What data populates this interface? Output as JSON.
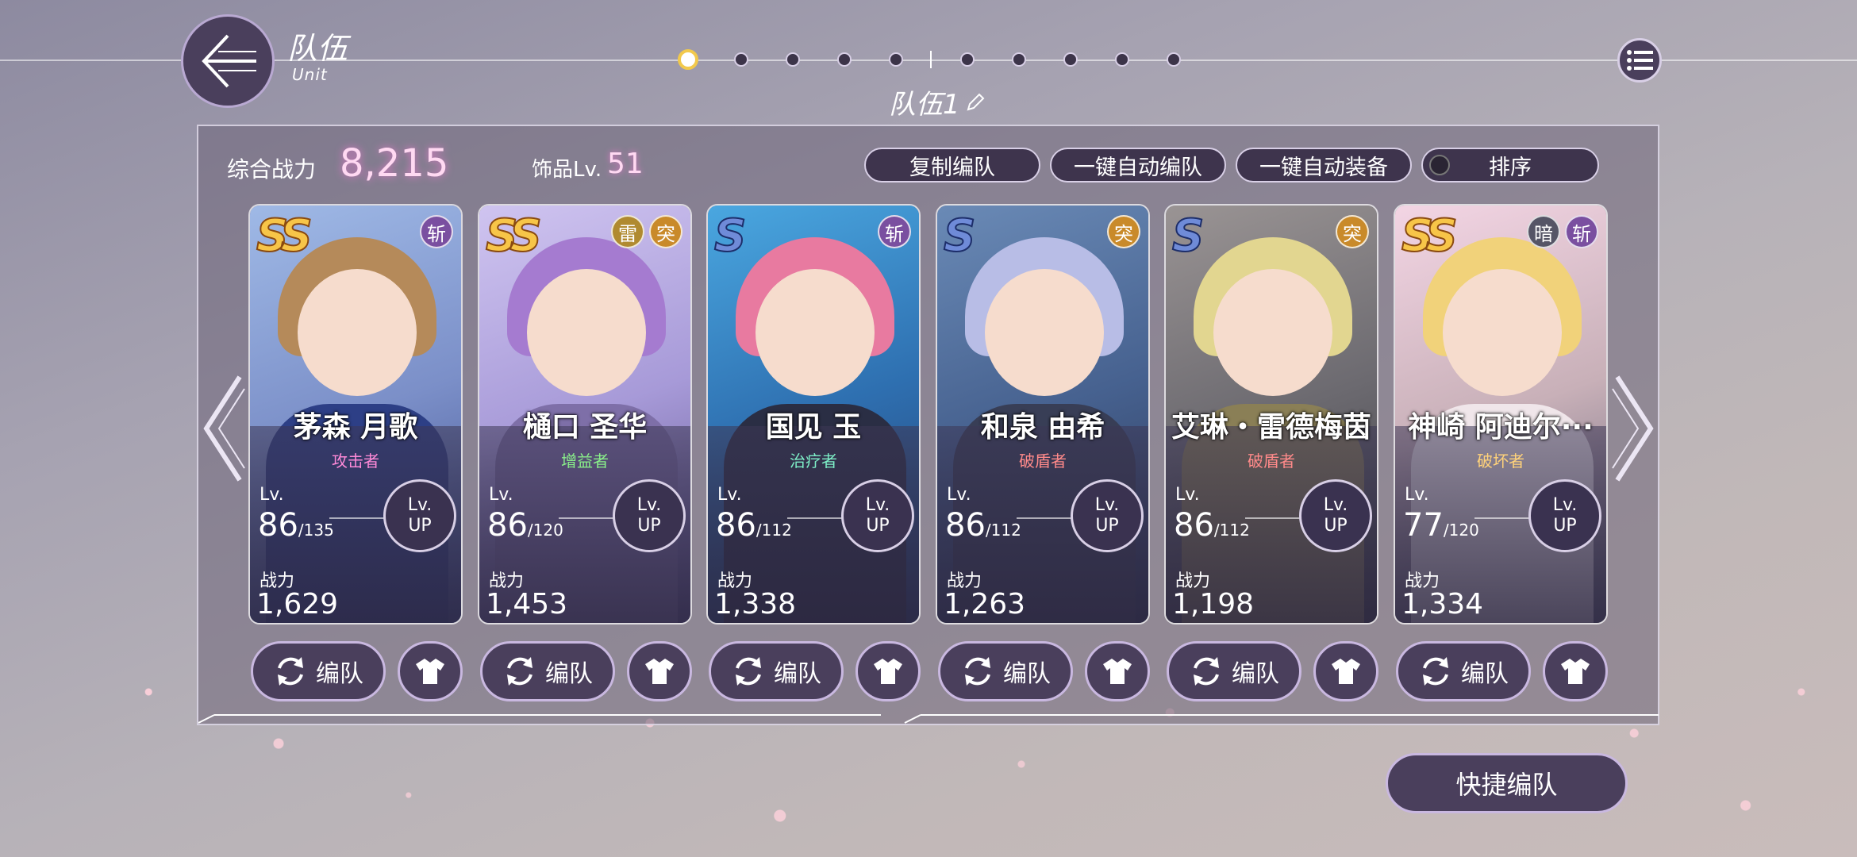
{
  "header": {
    "title": "队伍",
    "subtitle": "Unit",
    "team_name": "队伍1"
  },
  "team_dots": {
    "count": 10,
    "active_index": 0
  },
  "stats": {
    "power_label": "综合战力",
    "power_value": "8,215",
    "accessory_label": "饰品Lv.",
    "accessory_value": "51"
  },
  "toolbar": {
    "copy": "复制编队",
    "auto_team": "一键自动编队",
    "auto_equip": "一键自动装备",
    "sort": "排序"
  },
  "card_labels": {
    "lv": "Lv.",
    "lvup_top": "Lv.",
    "lvup_bottom": "UP",
    "power": "战力",
    "edit": "编队"
  },
  "characters": [
    {
      "name": "茅森 月歌",
      "role": "攻击者",
      "role_color": "#ff8ad8",
      "rarity": "SS",
      "badges": [
        "斩"
      ],
      "lv": "86",
      "lv_max": "/135",
      "power": "1,629"
    },
    {
      "name": "樋口 圣华",
      "role": "增益者",
      "role_color": "#8af08a",
      "rarity": "SS",
      "badges": [
        "雷",
        "突"
      ],
      "lv": "86",
      "lv_max": "/120",
      "power": "1,453"
    },
    {
      "name": "国见 玉",
      "role": "治疗者",
      "role_color": "#7ef0c8",
      "rarity": "S",
      "badges": [
        "斩"
      ],
      "lv": "86",
      "lv_max": "/112",
      "power": "1,338"
    },
    {
      "name": "和泉 由希",
      "role": "破盾者",
      "role_color": "#ff8a8a",
      "rarity": "S",
      "badges": [
        "突"
      ],
      "lv": "86",
      "lv_max": "/112",
      "power": "1,263"
    },
    {
      "name": "艾琳・雷德梅茵",
      "role": "破盾者",
      "role_color": "#ff8a8a",
      "rarity": "S",
      "badges": [
        "突"
      ],
      "lv": "86",
      "lv_max": "/112",
      "power": "1,198"
    },
    {
      "name": "神崎 阿迪尔···",
      "role": "破坏者",
      "role_color": "#ffd27a",
      "rarity": "SS",
      "badges": [
        "暗",
        "斩"
      ],
      "lv": "77",
      "lv_max": "/120",
      "power": "1,334"
    }
  ],
  "quick_button": "快捷编队",
  "colors": {
    "slash": "#7a4fa0",
    "thunder": "#b08a30",
    "pierce": "#c98a2a",
    "dark": "#555566",
    "accent": "#ffd9f2"
  }
}
